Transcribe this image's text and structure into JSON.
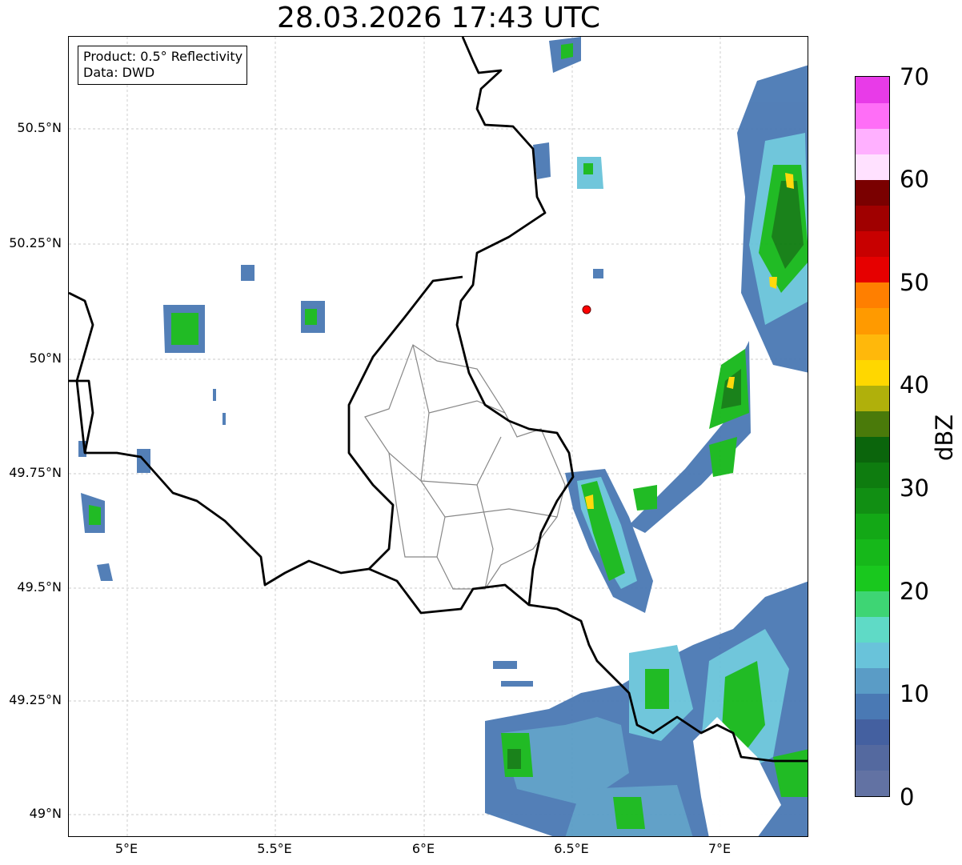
{
  "title": "28.03.2026 17:43 UTC",
  "info_box": {
    "product": "Product: 0.5° Reflectivity",
    "data": "Data: DWD"
  },
  "axes": {
    "y_ticks": [
      "50.5°N",
      "50.25°N",
      "50°N",
      "49.75°N",
      "49.5°N",
      "49.25°N",
      "49°N"
    ],
    "x_ticks": [
      "5°E",
      "5.5°E",
      "6°E",
      "6.5°E",
      "7°E"
    ],
    "lon_range": [
      4.8,
      7.3
    ],
    "lat_range": [
      48.95,
      50.7
    ]
  },
  "colorbar": {
    "label": "dBZ",
    "ticks": [
      "0",
      "10",
      "20",
      "30",
      "40",
      "50",
      "60",
      "70"
    ],
    "range": [
      0,
      70
    ],
    "colors": [
      "#6272a3",
      "#54699f",
      "#4460a0",
      "#4a79b4",
      "#5a9cc6",
      "#69c3da",
      "#5fdac6",
      "#3ed574",
      "#19c81e",
      "#16b81a",
      "#13a816",
      "#118f13",
      "#0e7c0f",
      "#0b650c",
      "#4a7a0a",
      "#b0b00b",
      "#ffd700",
      "#ffb80b",
      "#ff9a00",
      "#ff7f00",
      "#e60000",
      "#c80000",
      "#a00000",
      "#7a0000",
      "#ffe1ff",
      "#ffb0ff",
      "#ff6ef7",
      "#e83be8"
    ]
  },
  "radar_site": {
    "lon": 6.55,
    "lat": 50.1,
    "color": "#ff0000"
  }
}
